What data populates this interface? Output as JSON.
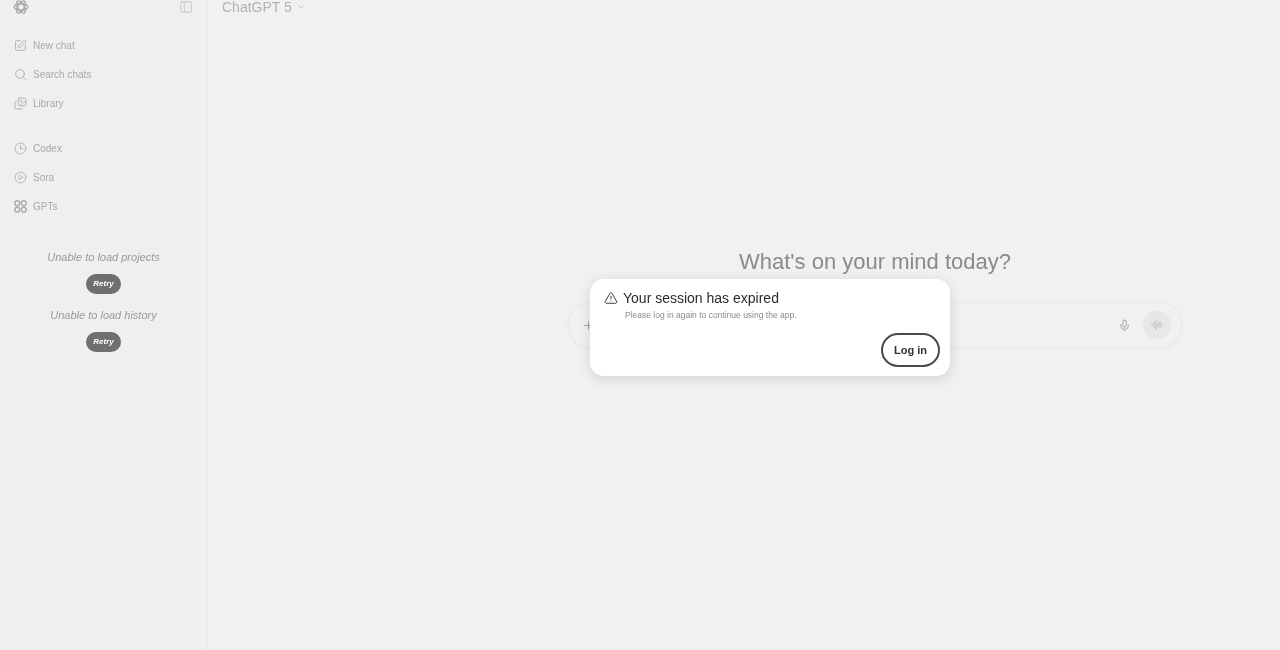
{
  "sidebar": {
    "nav_groups": [
      [
        {
          "label": "New chat"
        },
        {
          "label": "Search chats"
        },
        {
          "label": "Library"
        }
      ],
      [
        {
          "label": "Codex"
        },
        {
          "label": "Sora"
        },
        {
          "label": "GPTs"
        }
      ]
    ],
    "load_errors": [
      {
        "message": "Unable to load projects",
        "button": "Retry"
      },
      {
        "message": "Unable to load history",
        "button": "Retry"
      }
    ]
  },
  "header": {
    "model": "ChatGPT 5"
  },
  "main": {
    "heading": "What's on your mind today?"
  },
  "dialog": {
    "title": "Your session has expired",
    "message": "Please log in again to continue using the app.",
    "button": "Log in"
  }
}
